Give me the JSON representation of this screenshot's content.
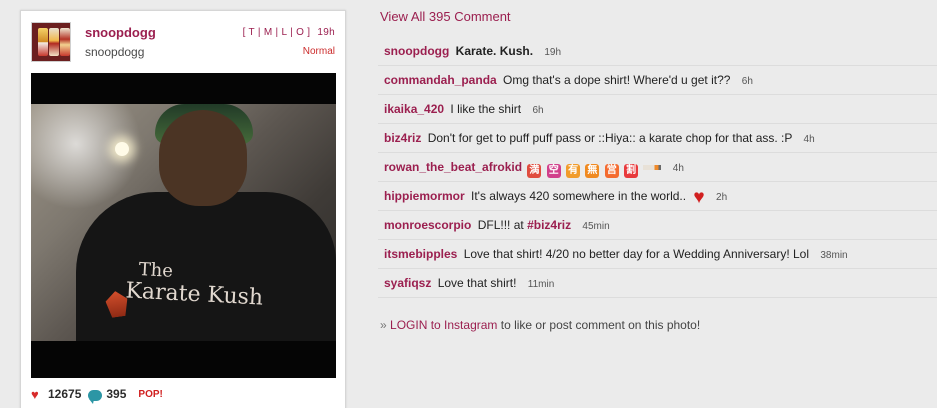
{
  "post": {
    "owner_username": "snoopdogg",
    "owner_display": "snoopdogg",
    "top_links": "[ T | M | L | O ]",
    "time": "19h",
    "filter": "Normal",
    "photo": {
      "shirt_text_line1": "The",
      "shirt_text_line2": "Karate Kush"
    },
    "likes": "12675",
    "comments_count": "395",
    "popular_badge": "POP!"
  },
  "comments_panel": {
    "view_all_label": "View All 395 Comment",
    "items": [
      {
        "user": "snoopdogg",
        "text": "Karate. Kush.",
        "time": "19h"
      },
      {
        "user": "commandah_panda",
        "text": "Omg that's a dope shirt! Where'd u get it??",
        "time": "6h"
      },
      {
        "user": "ikaika_420",
        "text": "I like the shirt",
        "time": "6h"
      },
      {
        "user": "biz4riz",
        "text": "Don't for get to puff puff pass or ::Hiya:: a karate chop for that ass. :P",
        "time": "4h"
      },
      {
        "user": "rowan_the_beat_afrokid",
        "text": "",
        "emoji": [
          "満",
          "空",
          "有",
          "無",
          "営",
          "割"
        ],
        "time": "4h"
      },
      {
        "user": "hippiemormor",
        "text": "It's always 420 somewhere in the world..",
        "time": "2h"
      },
      {
        "user": "monroescorpio",
        "text_before": "DFL!!! at",
        "hashtag": "#biz4riz",
        "time": "45min"
      },
      {
        "user": "itsmebipples",
        "text": "Love that shirt! 4/20 no better day for a Wedding Anniversary! Lol",
        "time": "38min"
      },
      {
        "user": "syafiqsz",
        "text": "Love that shirt!",
        "time": "11min"
      }
    ],
    "login_prefix": "»",
    "login_link": "LOGIN to Instagram",
    "login_suffix": "to like or post comment on this photo!"
  },
  "icons": {
    "like": "heart-icon",
    "comment": "speech-bubble-icon",
    "emoji_cigarette": "cigarette-icon",
    "emoji_heart": "red-heart-icon"
  },
  "colors": {
    "accent": "#9b1f4f",
    "background": "#ebebeb",
    "heart": "#d82b2b",
    "comment_bubble": "#2c96a5"
  }
}
